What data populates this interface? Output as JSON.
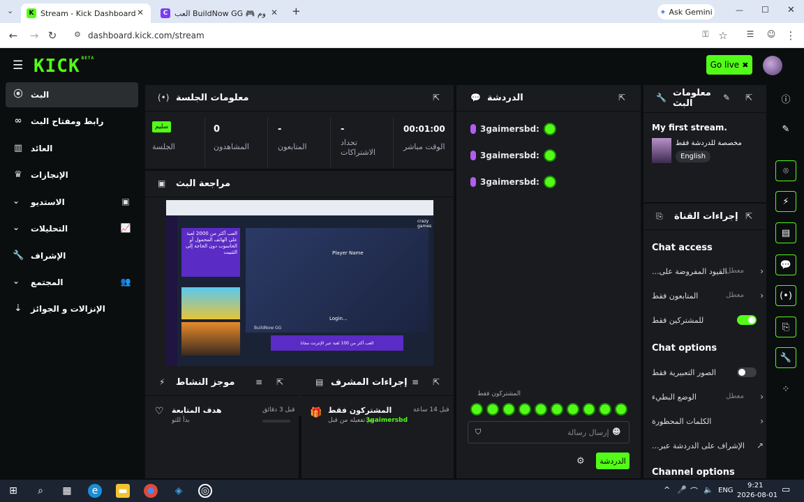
{
  "browser": {
    "tabs": [
      {
        "title": "Stream - Kick Dashboard",
        "close": "✕"
      },
      {
        "title": "العب BuildNow GG 🎮 على كروم",
        "close": "✕"
      }
    ],
    "new_tab": "+",
    "ask_gemini": "Ask Gemini",
    "url": "dashboard.kick.com/stream",
    "window_controls": [
      "—",
      "☐",
      "✕"
    ]
  },
  "app": {
    "logo": "KICK",
    "logo_badge": "BETA",
    "go_live": "Go live"
  },
  "sidebar": {
    "items": [
      {
        "label": "البث",
        "icon": "broadcast-icon"
      },
      {
        "label": "رابط ومفتاح البث",
        "icon": "link-icon"
      },
      {
        "label": "العائد",
        "icon": "chart-icon"
      },
      {
        "label": "الإنجازات",
        "icon": "trophy-icon"
      },
      {
        "label": "الاستديو",
        "icon": "studio-icon"
      },
      {
        "label": "التحليلات",
        "icon": "analytics-icon"
      },
      {
        "label": "الإشراف",
        "icon": "wrench-icon"
      },
      {
        "label": "المجتمع",
        "icon": "community-icon"
      },
      {
        "label": "الإنزالات و الجوائز",
        "icon": "drops-icon"
      }
    ]
  },
  "session_info": {
    "title": "معلومات الجلسة",
    "stats": [
      {
        "value": "00:01:00",
        "label": "الوقت مباشر"
      },
      {
        "value": "-",
        "label": "تحداد الاشتراكات"
      },
      {
        "value": "-",
        "label": "المتابعون"
      },
      {
        "value": "0",
        "label": "المشاهدون"
      },
      {
        "value": "سليم",
        "label": "الجلسة"
      }
    ]
  },
  "stream_preview": {
    "title": "مراجعة البث",
    "preview_text_banner": "العب أكثر من 2000 لعبة على الهاتف المحمول أو الحاسوب دون الحاجة إلى التثبيت",
    "game_title": "Player Name",
    "login_text": "Login...",
    "bottom_banner": "العب أكثر من 100 لعبة عبر الإنترنت مجانا",
    "brand": "BuildNow GG",
    "corner_brand": "crazy games"
  },
  "activity_feed": {
    "title": "موجز النشاط",
    "item": {
      "title": "هدف المتابعة",
      "subtitle": "بدأ للتو",
      "time": "قبل 3 دقائق"
    }
  },
  "mod_actions": {
    "title": "إجراءات المشرف",
    "item": {
      "title": "المشتركون فقط",
      "subtitle": "تم تفعيله من قبل",
      "user": "3gaimersbd",
      "time": "قبل 14 ساعة"
    }
  },
  "chat": {
    "title": "الدردشة",
    "messages": [
      {
        "user": "3gaimersbd:"
      },
      {
        "user": "3gaimersbd:"
      },
      {
        "user": "3gaimersbd:"
      }
    ],
    "subs_only": "المشتركون فقط",
    "input_placeholder": "إرسال رسالة",
    "send": "الدردشة"
  },
  "stream_info": {
    "title": "معلومات البث",
    "stream_title": "My first stream.",
    "category": "مخصصة للدردشة فقط",
    "language": "English"
  },
  "channel_actions": {
    "title": "إجراءات القناة",
    "chat_access_title": "Chat access",
    "access_rows": [
      {
        "label": "...القيود المفروضة على",
        "status": "معطل"
      },
      {
        "label": "المتابعون فقط",
        "status": "معطل"
      },
      {
        "label": "للمشتركين فقط",
        "status": ""
      }
    ],
    "chat_options_title": "Chat options",
    "option_rows": [
      {
        "label": "الصور التعبيرية فقط",
        "status": ""
      },
      {
        "label": "الوضع البطيء",
        "status": "معطل"
      },
      {
        "label": "الكلمات المحظورة",
        "status": ""
      },
      {
        "label": "...الإشراف على الدردشة عبر",
        "status": ""
      }
    ],
    "channel_options_title": "Channel options"
  },
  "taskbar": {
    "lang": "ENG",
    "time": "9:21",
    "date": "2026-08-01"
  }
}
